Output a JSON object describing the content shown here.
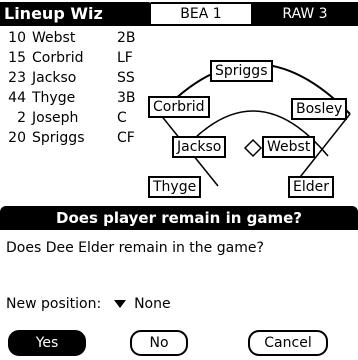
{
  "app": {
    "title": "Lineup Wiz"
  },
  "tabs": [
    {
      "label": "BEA 1"
    },
    {
      "label": "RAW 3"
    }
  ],
  "lineup": [
    {
      "num": "10",
      "name": "Webst",
      "pos": "2B"
    },
    {
      "num": "15",
      "name": "Corbrid",
      "pos": "LF"
    },
    {
      "num": "23",
      "name": "Jackso",
      "pos": "SS"
    },
    {
      "num": "44",
      "name": "Thyge",
      "pos": "3B"
    },
    {
      "num": "2",
      "name": "Joseph",
      "pos": "C"
    },
    {
      "num": "20",
      "name": "Spriggs",
      "pos": "CF"
    }
  ],
  "field": {
    "players": {
      "spriggs": "Spriggs",
      "corbrid": "Corbrid",
      "bosley": "Bosley",
      "jackso": "Jackso",
      "webst": "Webst",
      "thyge": "Thyge",
      "elder": "Elder"
    }
  },
  "dialog": {
    "title": "Does player remain in game?",
    "message": "Does Dee Elder remain in the game?",
    "position_label": "New position:",
    "position_value": "None",
    "buttons": {
      "yes": "Yes",
      "no": "No",
      "cancel": "Cancel"
    }
  }
}
